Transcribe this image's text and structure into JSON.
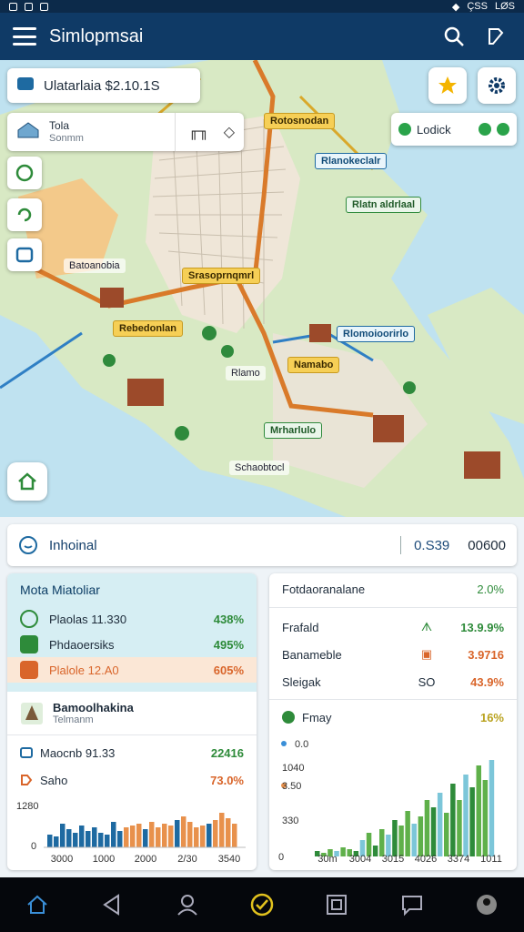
{
  "status": {
    "time": "LØS",
    "battery": "ÇSS"
  },
  "app": {
    "title": "Simlopmsai"
  },
  "map": {
    "search_value": "Ulatarlaia $2.10.1S",
    "place": {
      "title": "Tola",
      "subtitle": "Sonmm"
    },
    "route_chip": "Lodick",
    "labels": [
      {
        "text": "Rotosnodan",
        "style": "yel"
      },
      {
        "text": "Rlanokeclalr",
        "style": "blu"
      },
      {
        "text": "Rlatn aldrlaal",
        "style": "grn"
      },
      {
        "text": "Batoanobia",
        "style": "plain"
      },
      {
        "text": "Srasoprnqmrl",
        "style": "yel"
      },
      {
        "text": "Rebedonlan",
        "style": "yel"
      },
      {
        "text": "Rlomoioorirlo",
        "style": "blu"
      },
      {
        "text": "Rlamo",
        "style": "plain"
      },
      {
        "text": "Namabo",
        "style": "yel"
      },
      {
        "text": "Mrharlulo",
        "style": "grn"
      },
      {
        "text": "Schaobtocl",
        "style": "plain"
      }
    ]
  },
  "info": {
    "label": "Inhoinal",
    "value1": "0.S39",
    "value2": "00600"
  },
  "left_panel": {
    "title": "Mota Miatoliar",
    "rows": [
      {
        "name": "Plaolas 11.330",
        "pct": "438%",
        "tone": "green"
      },
      {
        "name": "Phdaoersiks",
        "pct": "495%",
        "tone": "green"
      },
      {
        "name": "Plalole 12.A0",
        "pct": "605%",
        "tone": "orange"
      }
    ],
    "sub": {
      "title": "Bamoolhakina",
      "subtitle": "Telmanm"
    },
    "stats": [
      {
        "name": "Maocnb 91.33",
        "val": "22416",
        "tone": "green"
      },
      {
        "name": "Saho",
        "val": "73.0%",
        "tone": "orange"
      }
    ],
    "chart": {
      "ytick": "1280",
      "y0": "0",
      "xticks": [
        "3000",
        "1000",
        "2000",
        "2/30",
        "3540"
      ]
    }
  },
  "right_panel": {
    "title": "Fotdaoranalane",
    "title_pct": "2.0%",
    "rows": [
      {
        "name": "Frafald",
        "val": "13.9.9%",
        "tone": "green"
      },
      {
        "name": "Banameble",
        "val": "3.9716",
        "tone": "orange"
      },
      {
        "name": "Sleigak",
        "icon_text": "SO",
        "val": "43.9%",
        "tone": "orange"
      }
    ],
    "legend": {
      "name": "Fmay",
      "val": "16%"
    },
    "chart": {
      "legend_val": "0.0",
      "yticks": [
        "1040",
        "3.50",
        "330",
        "0"
      ],
      "xticks": [
        "30m",
        "3004",
        "3015",
        "4026",
        "3374",
        "1011"
      ]
    }
  },
  "colors": {
    "appbar": "#0f3a66",
    "accent_green": "#2e8b3a",
    "accent_orange": "#d9652a",
    "water": "#bfe2f0",
    "land": "#d8e9c4"
  }
}
